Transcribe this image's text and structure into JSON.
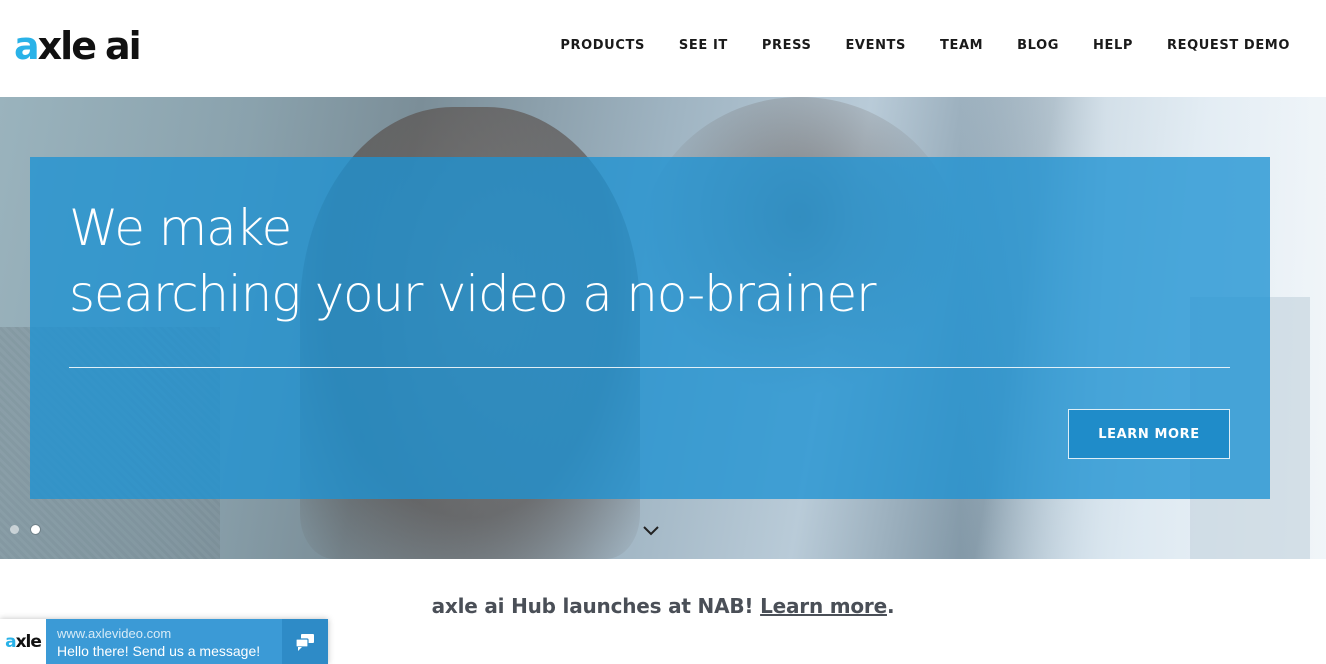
{
  "brand": {
    "logo_a": "a",
    "logo_rest": "xle",
    "logo_ai": "ai"
  },
  "nav": {
    "items": [
      {
        "label": "PRODUCTS"
      },
      {
        "label": "SEE IT"
      },
      {
        "label": "PRESS"
      },
      {
        "label": "EVENTS"
      },
      {
        "label": "TEAM"
      },
      {
        "label": "BLOG"
      },
      {
        "label": "HELP"
      },
      {
        "label": "REQUEST DEMO"
      }
    ]
  },
  "hero": {
    "headline_line1": "We make",
    "headline_line2": "searching your video a no-brainer",
    "button_label": "LEARN MORE",
    "slides": [
      {
        "active": false
      },
      {
        "active": true
      }
    ],
    "icons": {
      "scroll": "chevron-down-icon"
    }
  },
  "announcement": {
    "text": "axle ai Hub launches at NAB! ",
    "link_text": "Learn more",
    "suffix": "."
  },
  "chat": {
    "logo_a": "a",
    "logo_rest": "xle",
    "url": "www.axlevideo.com",
    "message": "Hello there! Send us a message!",
    "icon": "chat-bubbles-icon"
  },
  "colors": {
    "accent": "#29b2e8",
    "panel": "#1d92d2",
    "chat": "#3b9ad6",
    "text_dark": "#4a4f57"
  }
}
